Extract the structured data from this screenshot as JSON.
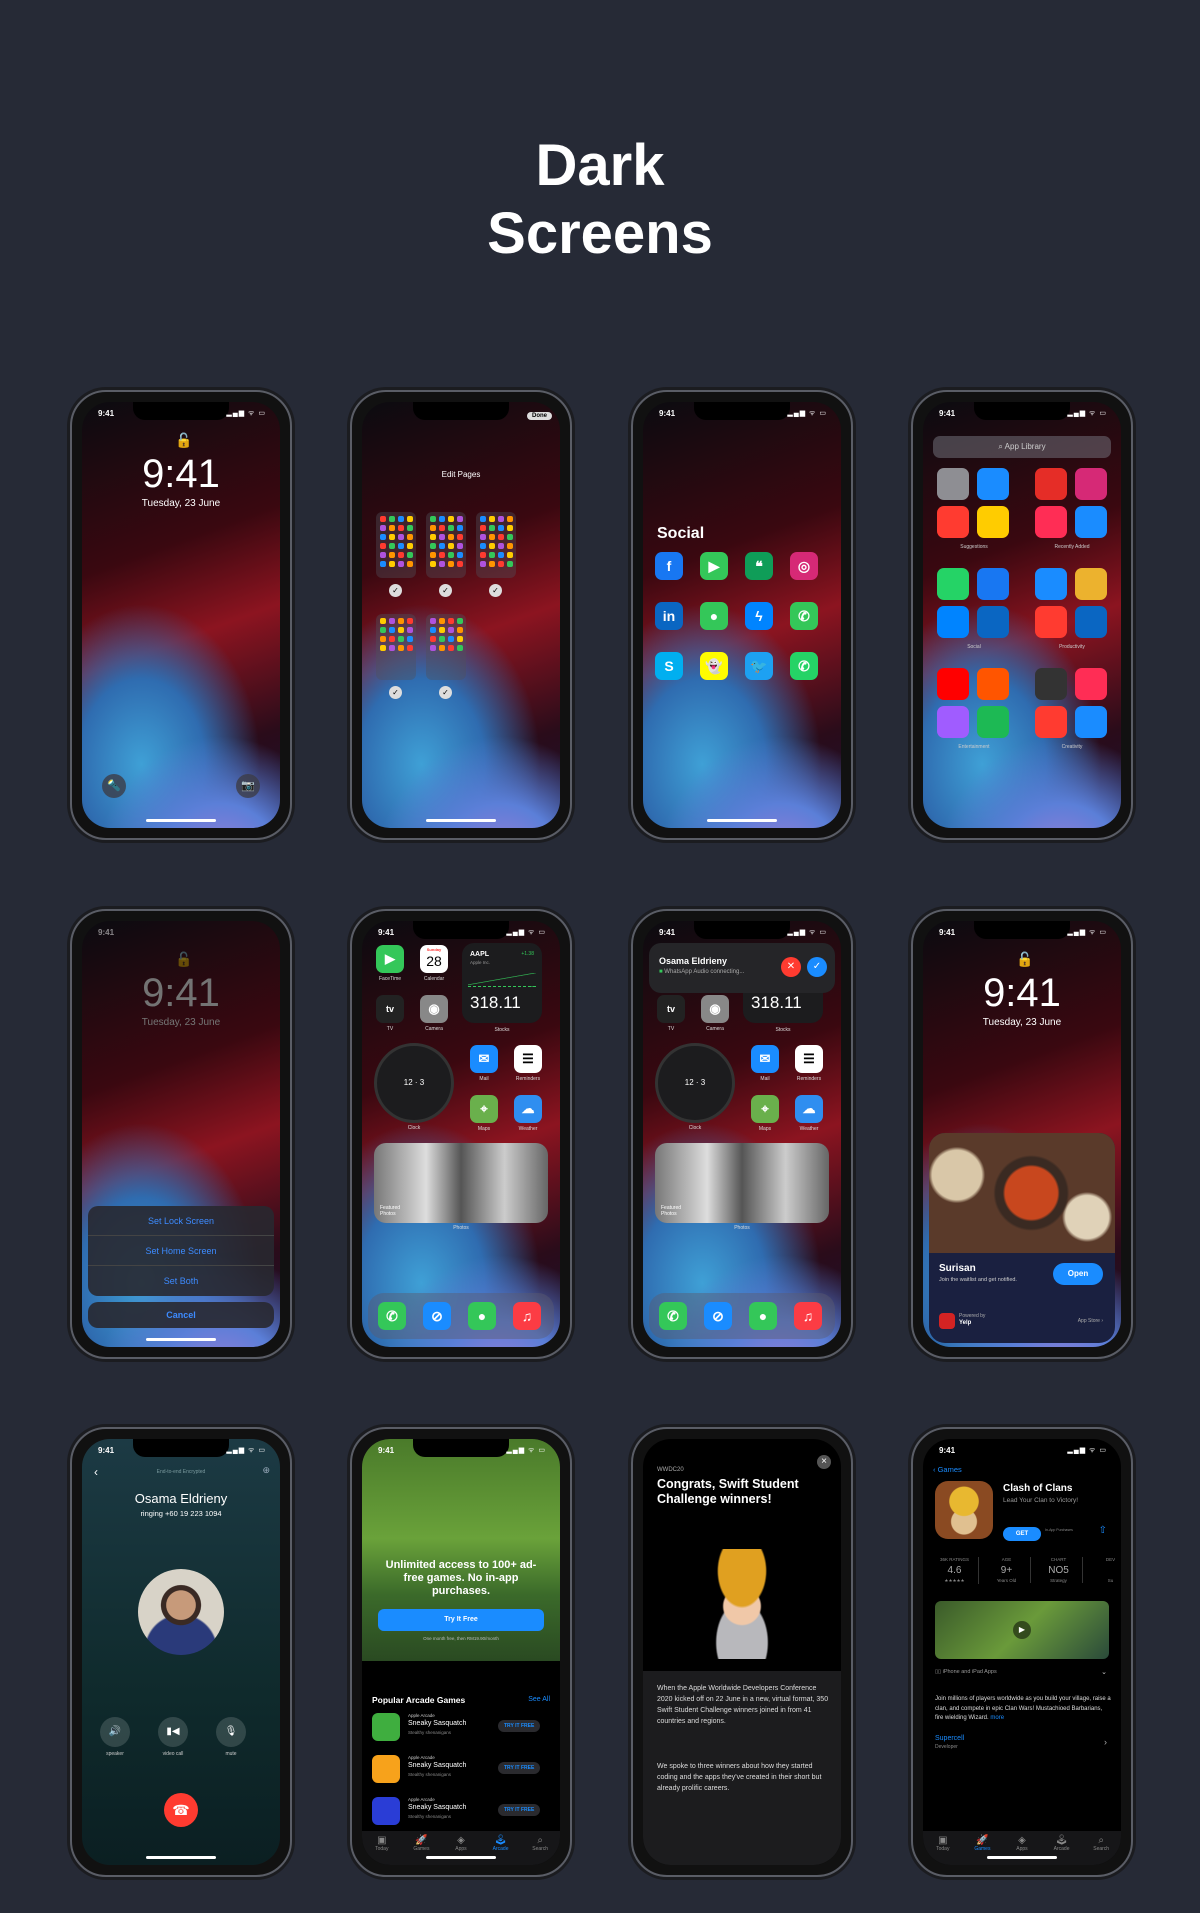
{
  "heading": {
    "line1": "Dark",
    "line2": "Screens"
  },
  "status": {
    "time": "9:41",
    "icons": "▂▄▆ ᯤ ▭"
  },
  "lock": {
    "time": "9:41",
    "date": "Tuesday, 23 June",
    "lock_icon": "unlock-icon",
    "flashlight_icon": "flashlight-icon",
    "camera_icon": "camera-icon"
  },
  "edit_pages": {
    "title": "Edit Pages",
    "done": "Done",
    "pages": 5,
    "check": "✓"
  },
  "social": {
    "title": "Social",
    "apps": [
      {
        "name": "facebook",
        "glyph": "f",
        "color": "#1877f2"
      },
      {
        "name": "facetime",
        "glyph": "▶",
        "color": "#34c759"
      },
      {
        "name": "hangouts",
        "glyph": "❝",
        "color": "#0f9d58"
      },
      {
        "name": "instagram",
        "glyph": "◎",
        "color": "#d62976"
      },
      {
        "name": "linkedin",
        "glyph": "in",
        "color": "#0a66c2"
      },
      {
        "name": "messages",
        "glyph": "●",
        "color": "#34c759"
      },
      {
        "name": "messenger",
        "glyph": "ϟ",
        "color": "#0084ff"
      },
      {
        "name": "phone",
        "glyph": "✆",
        "color": "#34c759"
      },
      {
        "name": "skype",
        "glyph": "S",
        "color": "#00aff0"
      },
      {
        "name": "snapchat",
        "glyph": "👻",
        "color": "#fffc00"
      },
      {
        "name": "twitter",
        "glyph": "🐦",
        "color": "#1da1f2"
      },
      {
        "name": "whatsapp",
        "glyph": "✆",
        "color": "#25d366"
      }
    ]
  },
  "app_library": {
    "search_placeholder": "App Library",
    "folders": [
      {
        "label": "Suggestions",
        "colors": [
          "#8e8e93",
          "#1a8cff",
          "#ff3b30",
          "#ffcc00"
        ]
      },
      {
        "label": "Recently Added",
        "colors": [
          "#e52d27",
          "#d62976",
          "#ff2d55",
          "#1a8cff"
        ]
      },
      {
        "label": "Social",
        "colors": [
          "#25d366",
          "#1877f2",
          "#0084ff",
          "#0a66c2"
        ]
      },
      {
        "label": "Productivity",
        "colors": [
          "#1a8cff",
          "#ecb22e",
          "#ff3b30",
          "#0a66c2"
        ]
      },
      {
        "label": "Entertainment",
        "colors": [
          "#ff0000",
          "#ff5500",
          "#a05cff",
          "#1db954"
        ]
      },
      {
        "label": "Creativity",
        "colors": [
          "#333333",
          "#ff2d55",
          "#ff3b30",
          "#1a8cff"
        ]
      }
    ]
  },
  "wallpaper_sheet": {
    "options": [
      "Set Lock Screen",
      "Set Home Screen",
      "Set Both"
    ],
    "cancel": "Cancel"
  },
  "home": {
    "facetime": "FaceTime",
    "calendar": "Calendar",
    "calendar_day": "Sunday",
    "calendar_date": "28",
    "stocks": {
      "ticker": "AAPL",
      "company": "Apple Inc.",
      "change": "+1.38",
      "price": "318.11",
      "label": "Stocks"
    },
    "tv": "TV",
    "camera": "Camera",
    "clock": "Clock",
    "mail": "Mail",
    "reminders": "Reminders",
    "maps": "Maps",
    "weather": "Weather",
    "photos": {
      "label": "Photos",
      "caption": "Featured Photos"
    },
    "dock": [
      {
        "name": "phone",
        "glyph": "✆",
        "color": "#34c759"
      },
      {
        "name": "safari",
        "glyph": "⊘",
        "color": "#1a8cff"
      },
      {
        "name": "messages",
        "glyph": "●",
        "color": "#34c759"
      },
      {
        "name": "music",
        "glyph": "♫",
        "color": "#fc3c44"
      }
    ],
    "accent_green": "#34c759"
  },
  "notification": {
    "caller": "Osama Eldrieny",
    "subtitle": "WhatsApp Audio connecting...",
    "decline_color": "#ff3b30",
    "accept_color": "#1a8cff"
  },
  "app_clip": {
    "name": "Surisan",
    "subtitle": "Join the waitlist and get notified.",
    "open": "Open",
    "powered_by": "Powered by",
    "provider": "Yelp",
    "store": "App Store ›"
  },
  "call": {
    "encrypted": "End-to-end Encrypted",
    "name": "Osama Eldrieny",
    "status": "ringing +60 19 223 1094",
    "buttons": [
      "speaker",
      "video call",
      "mute"
    ],
    "end_color": "#ff3b30"
  },
  "arcade": {
    "headline": "Unlimited access to 100+ ad-free games. No in-app purchases.",
    "cta": "Try It Free",
    "fine_print": "One month free, then RM19.90/month",
    "section": "Popular Arcade Games",
    "see_all": "See All",
    "games": [
      {
        "publisher": "Apple Arcade",
        "name": "Sneaky Sasquatch",
        "tagline": "Stealthy shenanigans",
        "button": "TRY IT FREE",
        "color": "#3fae3f"
      },
      {
        "publisher": "Apple Arcade",
        "name": "Sneaky Sasquatch",
        "tagline": "Stealthy shenanigans",
        "button": "TRY IT FREE",
        "color": "#f7a21b"
      },
      {
        "publisher": "Apple Arcade",
        "name": "Sneaky Sasquatch",
        "tagline": "Stealthy shenanigans",
        "button": "TRY IT FREE",
        "color": "#2a3dd6"
      }
    ],
    "tabs": [
      "Today",
      "Games",
      "Apps",
      "Arcade",
      "Search"
    ],
    "active_tab": "Arcade"
  },
  "wwdc": {
    "eyebrow": "WWDC20",
    "title": "Congrats, Swift Student Challenge winners!",
    "p1": "When the Apple Worldwide Developers Conference 2020 kicked off on 22 June in a new, virtual format, 350 Swift Student Challenge winners joined in from 41 countries and regions.",
    "p2": "We spoke to three winners about how they started coding and the apps they've created in their short but already prolific careers.",
    "close": "×"
  },
  "appstore": {
    "back": "Games",
    "name": "Clash of Clans",
    "subtitle": "Lead Your Clan to Victory!",
    "get": "GET",
    "iap": "In-App Purchases",
    "stats": [
      {
        "k": "36K RATINGS",
        "v": "4.6",
        "s": "★★★★★"
      },
      {
        "k": "AGE",
        "v": "9+",
        "s": "Years Old"
      },
      {
        "k": "CHART",
        "v": "NO5",
        "s": "Strategy"
      },
      {
        "k": "DEV",
        "v": "",
        "s": "Su"
      }
    ],
    "devices": "iPhone and iPad Apps",
    "description": "Join millions of players worldwide as you build your village, raise a clan,  and compete in epic Clan Wars! Mustachioed Barbarians, fire wielding Wizard.",
    "more": "more",
    "developer": "Supercell",
    "developer_label": "Developer",
    "tabs": [
      "Today",
      "Games",
      "Apps",
      "Arcade",
      "Search"
    ],
    "active_tab": "Games"
  }
}
